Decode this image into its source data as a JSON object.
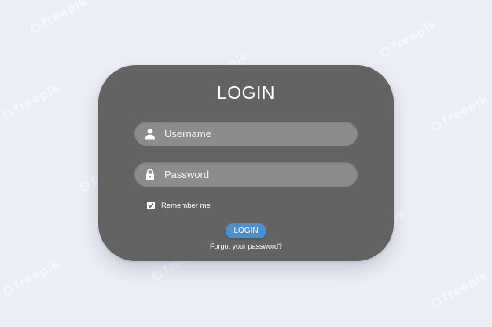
{
  "watermark": {
    "text": "freepik"
  },
  "login_form": {
    "title": "LOGIN",
    "username": {
      "placeholder": "Username",
      "icon": "user-icon"
    },
    "password": {
      "placeholder": "Password",
      "icon": "lock-icon"
    },
    "remember": {
      "label": "Remember me",
      "checked": true
    },
    "submit_label": "LOGIN",
    "forgot_label": "Forgot your password?"
  },
  "colors": {
    "background": "#eceef5",
    "card": "#636363",
    "field": "#8c8c8c",
    "button": "#4b8fcf",
    "text": "#ffffff"
  }
}
